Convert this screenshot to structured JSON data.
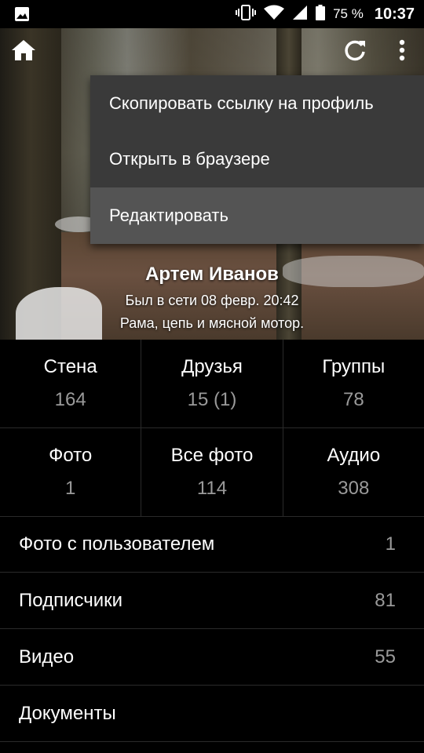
{
  "status_bar": {
    "battery_percent": "75 %",
    "time": "10:37",
    "icons": [
      "image-notification-icon",
      "vibrate-icon",
      "wifi-icon",
      "signal-icon",
      "battery-icon"
    ]
  },
  "header": {
    "home_icon": "home-icon",
    "refresh_icon": "refresh-icon",
    "more_icon": "more-vert-icon"
  },
  "profile": {
    "name": "Артем Иванов",
    "last_seen": "Был в сети 08 февр. 20:42",
    "motto": "Рама, цепь и мясной мотор."
  },
  "menu": {
    "items": [
      {
        "label": "Скопировать ссылку на профиль"
      },
      {
        "label": "Открыть в браузере"
      },
      {
        "label": "Редактировать"
      }
    ]
  },
  "grid": {
    "row1": [
      {
        "label": "Стена",
        "value": "164"
      },
      {
        "label": "Друзья",
        "value": "15 (1)"
      },
      {
        "label": "Группы",
        "value": "78"
      }
    ],
    "row2": [
      {
        "label": "Фото",
        "value": "1"
      },
      {
        "label": "Все фото",
        "value": "114"
      },
      {
        "label": "Аудио",
        "value": "308"
      }
    ]
  },
  "list": [
    {
      "label": "Фото с пользователем",
      "value": "1"
    },
    {
      "label": "Подписчики",
      "value": "81"
    },
    {
      "label": "Видео",
      "value": "55"
    },
    {
      "label": "Документы",
      "value": ""
    }
  ],
  "colors": {
    "background": "#000000",
    "menu_bg": "#3a3a3a",
    "menu_highlight": "#545454",
    "secondary_text": "#9a9a9a"
  }
}
